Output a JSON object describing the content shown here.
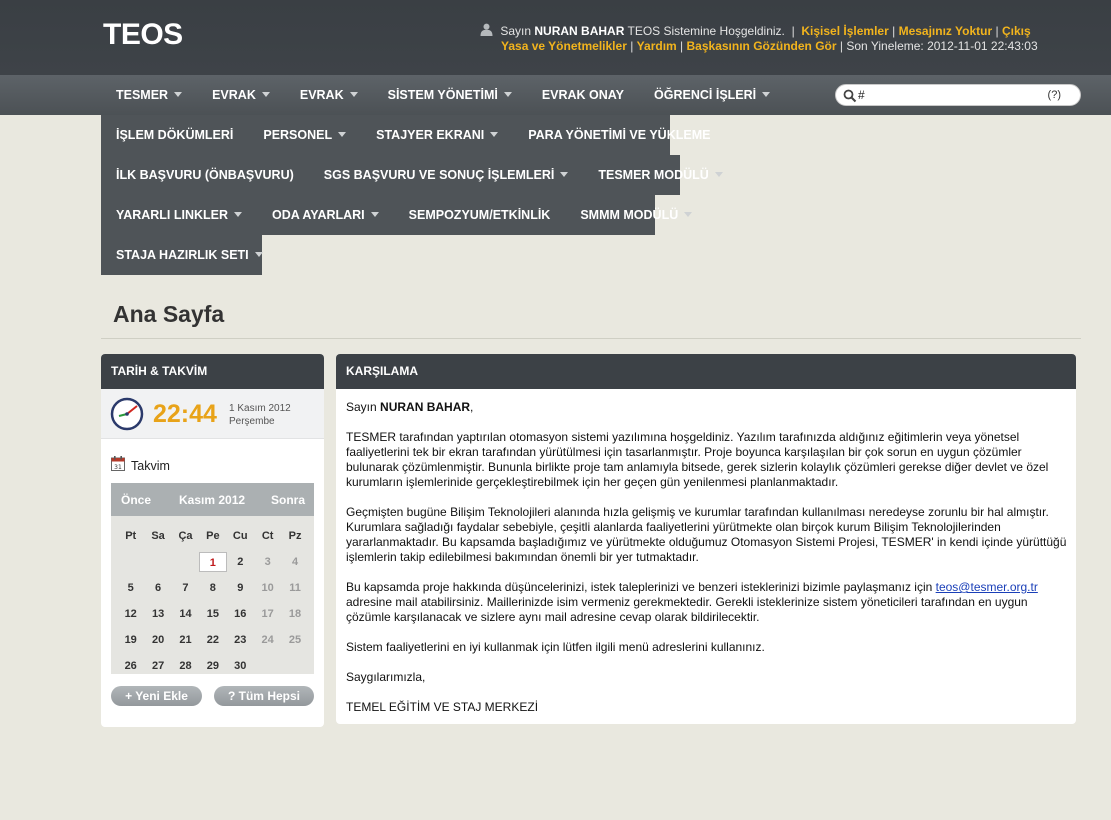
{
  "header": {
    "logo": "TEOS",
    "greeting_prefix": "Sayın",
    "user_name": "NURAN BAHAR",
    "greeting_suffix": "TEOS Sistemine Hoşgeldiniz.",
    "sep": "|",
    "links_line1": [
      "Kişisel İşlemler",
      "Mesajınız Yoktur",
      "Çıkış"
    ],
    "links_line2": [
      "Yasa ve Yönetmelikler",
      "Yardım",
      "Başkasının Gözünden Gör"
    ],
    "last_refresh": "Son Yineleme: 2012-11-01 22:43:03"
  },
  "menu": {
    "rows": [
      [
        {
          "label": "TESMER",
          "caret": true
        },
        {
          "label": "EVRAK",
          "caret": true
        },
        {
          "label": "EVRAK",
          "caret": true
        },
        {
          "label": "SİSTEM YÖNETİMİ",
          "caret": true
        },
        {
          "label": "EVRAK ONAY",
          "caret": false
        },
        {
          "label": "ÖĞRENCİ İŞLERİ",
          "caret": true
        }
      ],
      [
        {
          "label": "İŞLEM DÖKÜMLERİ",
          "caret": false
        },
        {
          "label": "PERSONEL",
          "caret": true
        },
        {
          "label": "STAJYER EKRANI",
          "caret": true
        },
        {
          "label": "PARA YÖNETİMİ VE YÜKLEME",
          "caret": false
        }
      ],
      [
        {
          "label": "İLK BAŞVURU (ÖNBAŞVURU)",
          "caret": false
        },
        {
          "label": "SGS BAŞVURU VE SONUÇ İŞLEMLERİ",
          "caret": true
        },
        {
          "label": "TESMER MODÜLÜ",
          "caret": true
        }
      ],
      [
        {
          "label": "YARARLI LINKLER",
          "caret": true
        },
        {
          "label": "ODA AYARLARI",
          "caret": true
        },
        {
          "label": "SEMPOZYUM/ETKİNLİK",
          "caret": false
        },
        {
          "label": "SMMM MODÜLÜ",
          "caret": true
        }
      ],
      [
        {
          "label": "STAJA HAZIRLIK SETI",
          "caret": true
        }
      ]
    ]
  },
  "search": {
    "value": "#",
    "help": "(?)"
  },
  "page": {
    "title": "Ana Sayfa"
  },
  "datetime_panel": {
    "heading": "TARİH & TAKVİM",
    "time": "22:44",
    "date": "1 Kasım 2012",
    "weekday": "Perşembe",
    "calendar_label": "Takvim",
    "prev": "Önce",
    "month": "Kasım 2012",
    "next": "Sonra",
    "weekdays": [
      "Pt",
      "Sa",
      "Ça",
      "Pe",
      "Cu",
      "Ct",
      "Pz"
    ],
    "today": "1",
    "weeks": [
      [
        "",
        "",
        "",
        "1",
        "2",
        "3",
        "4"
      ],
      [
        "5",
        "6",
        "7",
        "8",
        "9",
        "10",
        "11"
      ],
      [
        "12",
        "13",
        "14",
        "15",
        "16",
        "17",
        "18"
      ],
      [
        "19",
        "20",
        "21",
        "22",
        "23",
        "24",
        "25"
      ],
      [
        "26",
        "27",
        "28",
        "29",
        "30",
        "",
        ""
      ]
    ],
    "add_button": "+ Yeni Ekle",
    "all_button": "? Tüm Hepsi"
  },
  "welcome_panel": {
    "heading": "KARŞILAMA",
    "salutation_prefix": "Sayın",
    "salutation_name": "NURAN BAHAR",
    "salutation_suffix": ",",
    "p1": "TESMER tarafından yaptırılan otomasyon sistemi yazılımına hoşgeldiniz. Yazılım tarafınızda aldığınız eğitimlerin veya yönetsel faaliyetlerini tek bir ekran tarafından yürütülmesi için tasarlanmıştır. Proje boyunca karşılaşılan bir çok sorun en uygun çözümler bulunarak çözümlenmiştir. Bununla birlikte proje tam anlamıyla bitsede, gerek sizlerin kolaylık çözümleri gerekse diğer devlet ve özel kurumların işlemlerinide gerçekleştirebilmek için her geçen gün yenilenmesi planlanmaktadır.",
    "p2": "Geçmişten bugüne Bilişim Teknolojileri alanında hızla gelişmiş ve kurumlar tarafından kullanılması neredeyse zorunlu bir hal almıştır. Kurumlara sağladığı faydalar sebebiyle, çeşitli alanlarda faaliyetlerini yürütmekte olan birçok kurum Bilişim Teknolojilerinden yararlanmaktadır. Bu kapsamda başladığımız ve yürütmekte olduğumuz Otomasyon Sistemi Projesi, TESMER' in kendi içinde yürüttüğü işlemlerin takip edilebilmesi bakımından önemli bir yer tutmaktadır.",
    "p3_before": "Bu kapsamda proje hakkında düşüncelerinizi, istek taleplerinizi ve benzeri isteklerinizi bizimle paylaşmanız için",
    "p3_email": "teos@tesmer.org.tr",
    "p3_after": "adresine mail atabilirsiniz. Maillerinizde isim vermeniz gerekmektedir. Gerekli isteklerinize sistem yöneticileri tarafından en uygun çözümle karşılanacak ve sizlere aynı mail adresine cevap olarak bildirilecektir.",
    "p4": "Sistem faaliyetlerini en iyi kullanmak için lütfen ilgili menü adreslerini kullanınız.",
    "closing": "Saygılarımızla,",
    "signature": "TEMEL EĞİTİM VE STAJ MERKEZİ"
  },
  "colors": {
    "header": "#3e4348",
    "accent_yellow": "#f2b41d",
    "clock_orange": "#e8a319",
    "today_red": "#c0191b",
    "background": "#e9e8df"
  }
}
